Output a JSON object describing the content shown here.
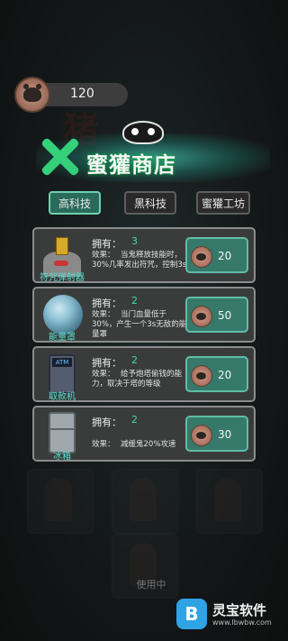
{
  "player": {
    "coins": "120"
  },
  "header": {
    "title": "蜜獾商店",
    "bg_text": "猪"
  },
  "tabs": [
    {
      "label": "高科技",
      "active": true
    },
    {
      "label": "黑科技",
      "active": false
    },
    {
      "label": "蜜獾工坊",
      "active": false
    }
  ],
  "items": [
    {
      "name": "符咒弹射器",
      "owned_label": "拥有：",
      "owned": "3",
      "effect_label": "效果：",
      "effect": "当鬼释放技能时，30%几率发出符咒，控制3s",
      "price": "20",
      "icon": "talisman-turret-icon"
    },
    {
      "name": "能量罩",
      "owned_label": "拥有：",
      "owned": "2",
      "effect_label": "效果：",
      "effect": "当门血量低于30%，产生一个3s无敌的能量罩",
      "price": "50",
      "icon": "energy-shield-icon"
    },
    {
      "name": "取款机",
      "owned_label": "拥有：",
      "owned": "2",
      "effect_label": "效果：",
      "effect": "给予炮塔偷钱的能力，取决于塔的等级",
      "price": "20",
      "icon": "atm-icon"
    },
    {
      "name": "冰箱",
      "owned_label": "拥有：",
      "owned": "2",
      "effect_label": "效果：",
      "effect": "减缓鬼20%攻速",
      "price": "30",
      "icon": "fridge-icon"
    }
  ],
  "background": {
    "in_use_label": "使用中"
  },
  "watermark": {
    "brand": "灵宝软件",
    "url": "www.lbwbw.com",
    "logo_letter": "B"
  },
  "colors": {
    "accent": "#34d07a",
    "owned_value": "#33e0a0",
    "buy_button": "#36796a",
    "tab_active": "#2a6a5a"
  }
}
